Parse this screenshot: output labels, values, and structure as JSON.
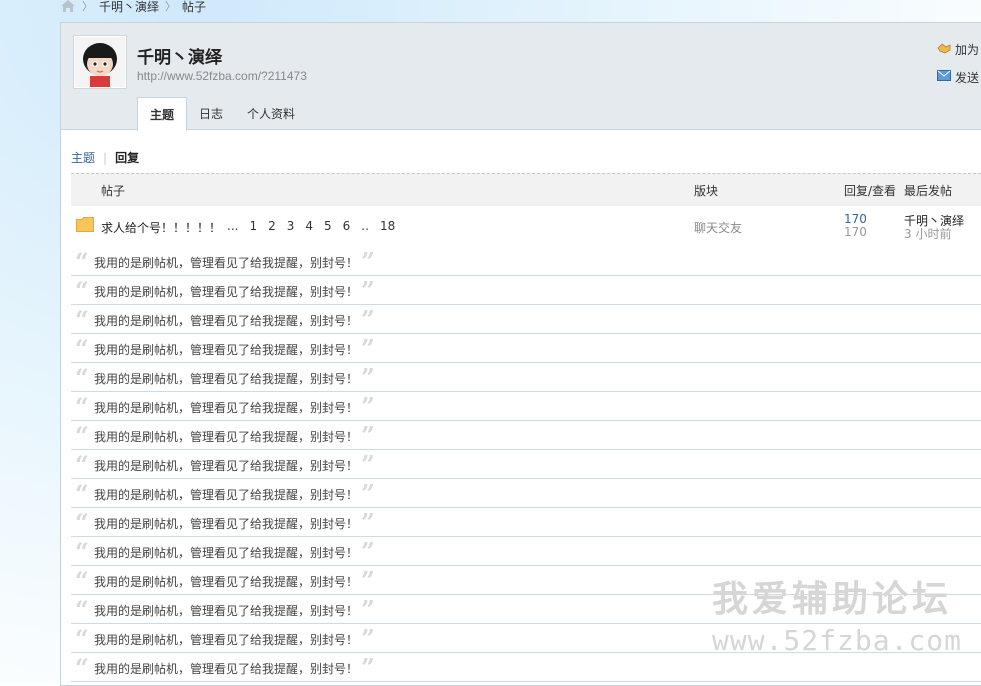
{
  "breadcrumb": {
    "items": [
      "千明丶演绎",
      "帖子"
    ]
  },
  "profile": {
    "username": "千明丶演绎",
    "homepage_url": "http://www.52fzba.com/?211473",
    "tabs": [
      {
        "label": "主题",
        "active": true
      },
      {
        "label": "日志",
        "active": false
      },
      {
        "label": "个人资料",
        "active": false
      }
    ],
    "actions": [
      {
        "label": "加为",
        "icon": "add-friend-icon"
      },
      {
        "label": "发送",
        "icon": "envelope-icon"
      }
    ]
  },
  "subnav": {
    "topics_label": "主题",
    "replies_label": "回复"
  },
  "table": {
    "headers": {
      "post": "帖子",
      "forum": "版块",
      "stats": "回复/查看",
      "last": "最后发帖"
    },
    "thread": {
      "title": "求人给个号！！！！！",
      "pager": [
        "...",
        "1",
        "2",
        "3",
        "4",
        "5",
        "6",
        "..",
        "18"
      ],
      "forum": "聊天交友",
      "replies": "170",
      "views": "170",
      "last_user": "千明丶演绎",
      "last_time": "3 小时前"
    },
    "reply_items": [
      "我用的是刷帖机，管理看见了给我提醒，别封号！",
      "我用的是刷帖机，管理看见了给我提醒，别封号！",
      "我用的是刷帖机，管理看见了给我提醒，别封号！",
      "我用的是刷帖机，管理看见了给我提醒，别封号！",
      "我用的是刷帖机，管理看见了给我提醒，别封号！",
      "我用的是刷帖机，管理看见了给我提醒，别封号！",
      "我用的是刷帖机，管理看见了给我提醒，别封号！",
      "我用的是刷帖机，管理看见了给我提醒，别封号！",
      "我用的是刷帖机，管理看见了给我提醒，别封号！",
      "我用的是刷帖机，管理看见了给我提醒，别封号！",
      "我用的是刷帖机，管理看见了给我提醒，别封号！",
      "我用的是刷帖机，管理看见了给我提醒，别封号！",
      "我用的是刷帖机，管理看见了给我提醒，别封号！",
      "我用的是刷帖机，管理看见了给我提醒，别封号！",
      "我用的是刷帖机，管理看见了给我提醒，别封号！"
    ],
    "quote_open": "“",
    "quote_close": "”"
  },
  "watermark": {
    "line1": "我爱辅助论坛",
    "line2": "www.52fzba.com"
  },
  "colors": {
    "link": "#336699",
    "header_bg": "#e4eaee",
    "row_border": "#cddbe6"
  }
}
